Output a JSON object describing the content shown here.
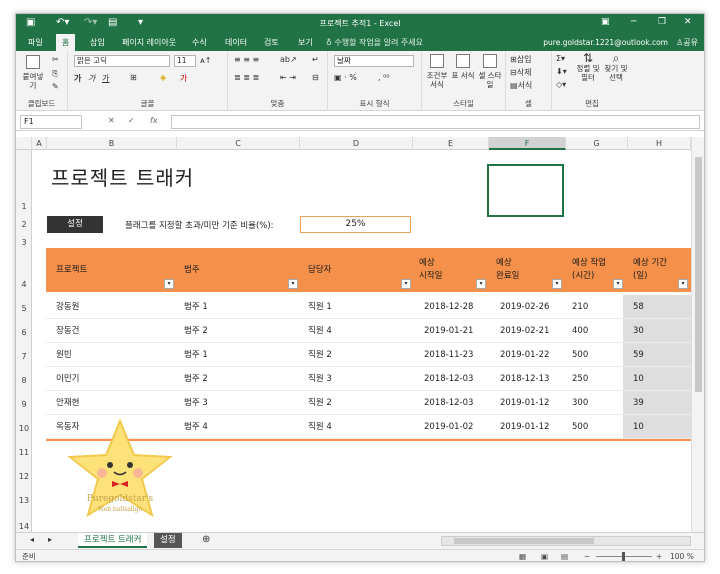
{
  "titlebar": {
    "title": "프로젝트 추적1 - Excel"
  },
  "ribbon_tabs": [
    "파일",
    "홈",
    "삽입",
    "페이지 레이아웃",
    "수식",
    "데이터",
    "검토",
    "보기"
  ],
  "tell_me": "수행할 작업을 알려 주세요",
  "account": "pure.goldstar.1221@outlook.com",
  "share": "공유",
  "ribbon": {
    "paste": "붙여넣기",
    "clipboard_label": "클립보드",
    "font_name": "맑은 고딕",
    "font_size": "11",
    "font_label": "글꼴",
    "align_label": "맞춤",
    "number_format": "날짜",
    "number_label": "표시 형식",
    "cond_format": "조건부 서식",
    "table_format": "표 서식",
    "cell_style": "셀 스타일",
    "style_label": "스타일",
    "insert": "삽입",
    "delete": "삭제",
    "format": "서식",
    "cells_label": "셀",
    "sort_filter": "정렬 및 필터",
    "find_select": "찾기 및 선택",
    "edit_label": "편집"
  },
  "namebox": "F1",
  "columns": [
    "A",
    "B",
    "C",
    "D",
    "E",
    "F",
    "G",
    "H"
  ],
  "rows": [
    "1",
    "2",
    "3",
    "4",
    "5",
    "6",
    "7",
    "8",
    "9",
    "10",
    "11",
    "12",
    "13",
    "14"
  ],
  "sheet": {
    "title": "프로젝트 트래커",
    "settings_button": "설정",
    "threshold_label": "플래그를 지정할 초과/미만 기준 비율(%):",
    "threshold_value": "25%",
    "headers": {
      "project": "프로젝트",
      "category": "범주",
      "owner": "담당자",
      "est_start_1": "예상",
      "est_start_2": "시작일",
      "est_end_1": "예상",
      "est_end_2": "완료일",
      "est_work_1": "예상 작업",
      "est_work_2": "(시간)",
      "est_dur_1": "예상 기간",
      "est_dur_2": "(일)"
    },
    "table_rows": [
      {
        "project": "강동원",
        "category": "범주 1",
        "owner": "직원 1",
        "start": "2018-12-28",
        "end": "2019-02-26",
        "work": "210",
        "dur": "58"
      },
      {
        "project": "장동건",
        "category": "범주 2",
        "owner": "직원 4",
        "start": "2019-01-21",
        "end": "2019-02-21",
        "work": "400",
        "dur": "30"
      },
      {
        "project": "원빈",
        "category": "범주 1",
        "owner": "직원 2",
        "start": "2018-11-23",
        "end": "2019-01-22",
        "work": "500",
        "dur": "59"
      },
      {
        "project": "이민기",
        "category": "범주 2",
        "owner": "직원 3",
        "start": "2018-12-03",
        "end": "2018-12-13",
        "work": "250",
        "dur": "10"
      },
      {
        "project": "안재현",
        "category": "범주 3",
        "owner": "직원 2",
        "start": "2018-12-03",
        "end": "2019-01-12",
        "work": "300",
        "dur": "39"
      },
      {
        "project": "옥동자",
        "category": "범주 4",
        "owner": "직원 4",
        "start": "2019-01-02",
        "end": "2019-01-12",
        "work": "500",
        "dur": "10"
      }
    ]
  },
  "sheet_tabs": [
    "프로젝트 트래커",
    "설정"
  ],
  "status": {
    "left": "준비",
    "zoom": "100 %"
  },
  "mascot": {
    "line1": "Puregoldstar's",
    "line2": "Web ballsallgo"
  },
  "colors": {
    "excel_green": "#217346",
    "header_orange": "#f4904a"
  }
}
